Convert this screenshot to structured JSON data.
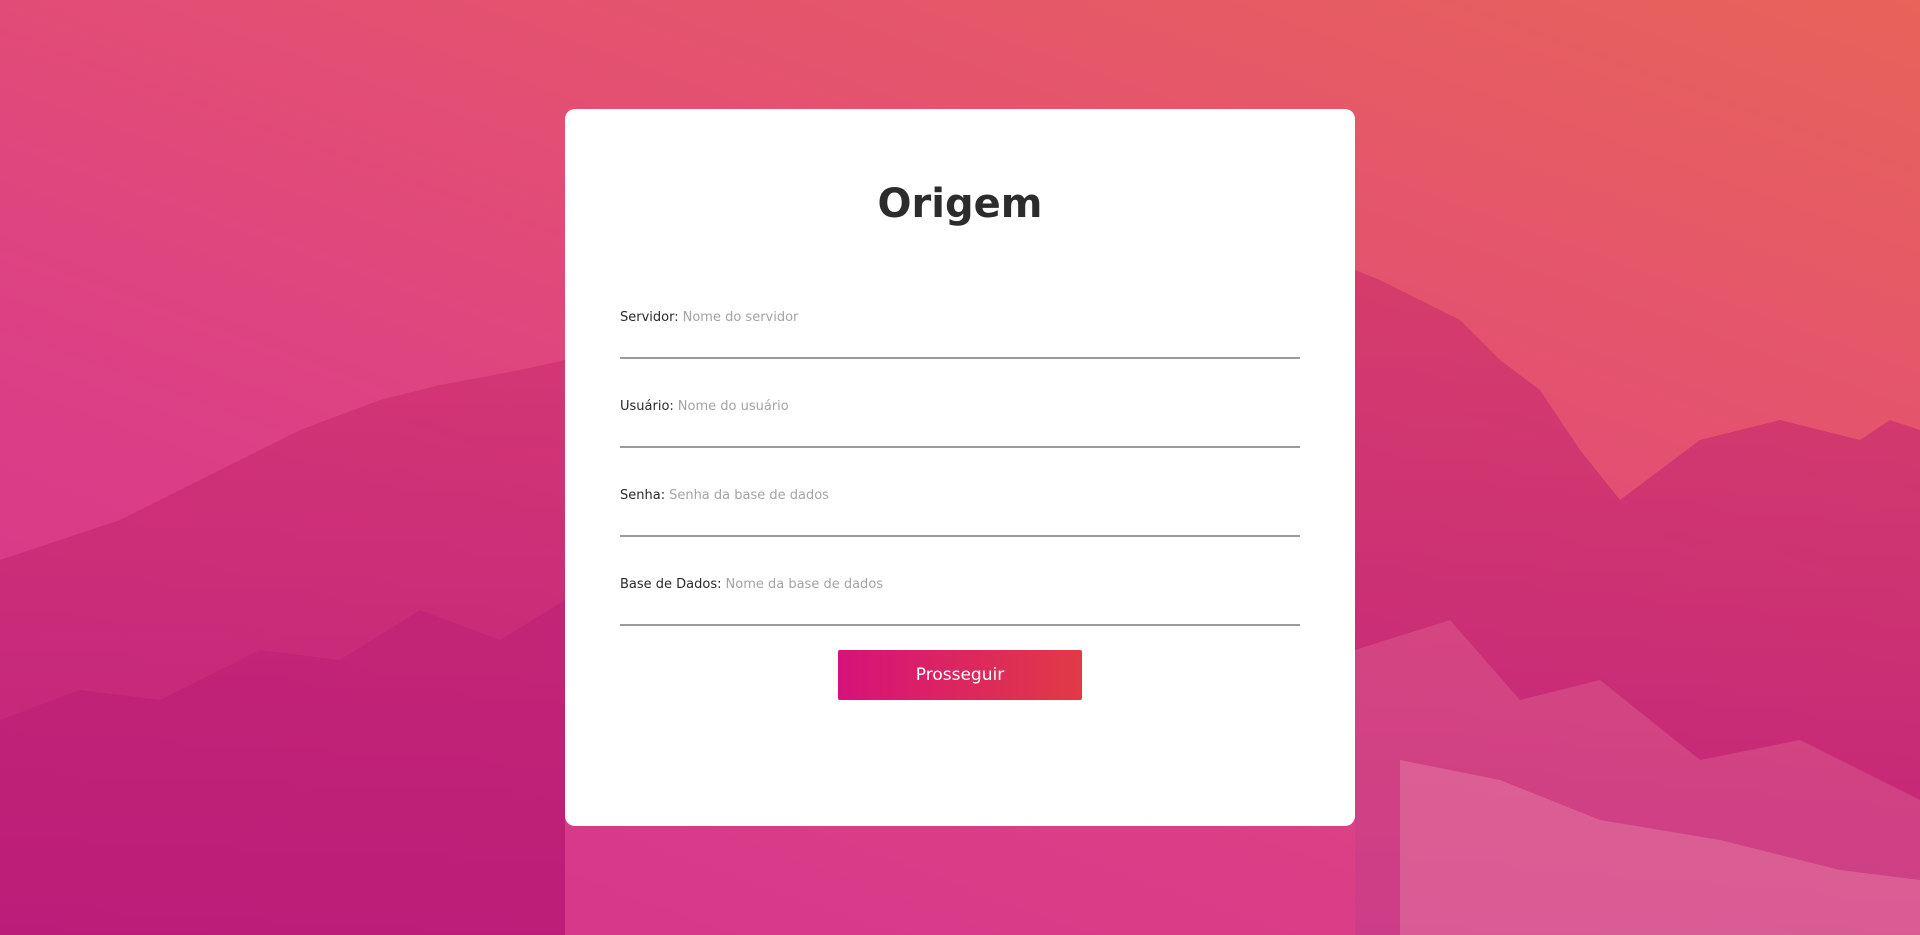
{
  "form": {
    "title": "Origem",
    "fields": [
      {
        "label": "Servidor:",
        "placeholder": "Nome do servidor",
        "value": ""
      },
      {
        "label": "Usuário:",
        "placeholder": "Nome do usuário",
        "value": ""
      },
      {
        "label": "Senha:",
        "placeholder": "Senha da base de dados",
        "value": ""
      },
      {
        "label": "Base de Dados:",
        "placeholder": "Nome da base de dados",
        "value": ""
      }
    ],
    "submit_label": "Prosseguir"
  },
  "colors": {
    "gradient_start": "#d4338d",
    "gradient_end": "#e8635a",
    "button_start": "#d6127a",
    "button_end": "#e13a45",
    "card": "#ffffff",
    "title": "#2c2c2c"
  }
}
